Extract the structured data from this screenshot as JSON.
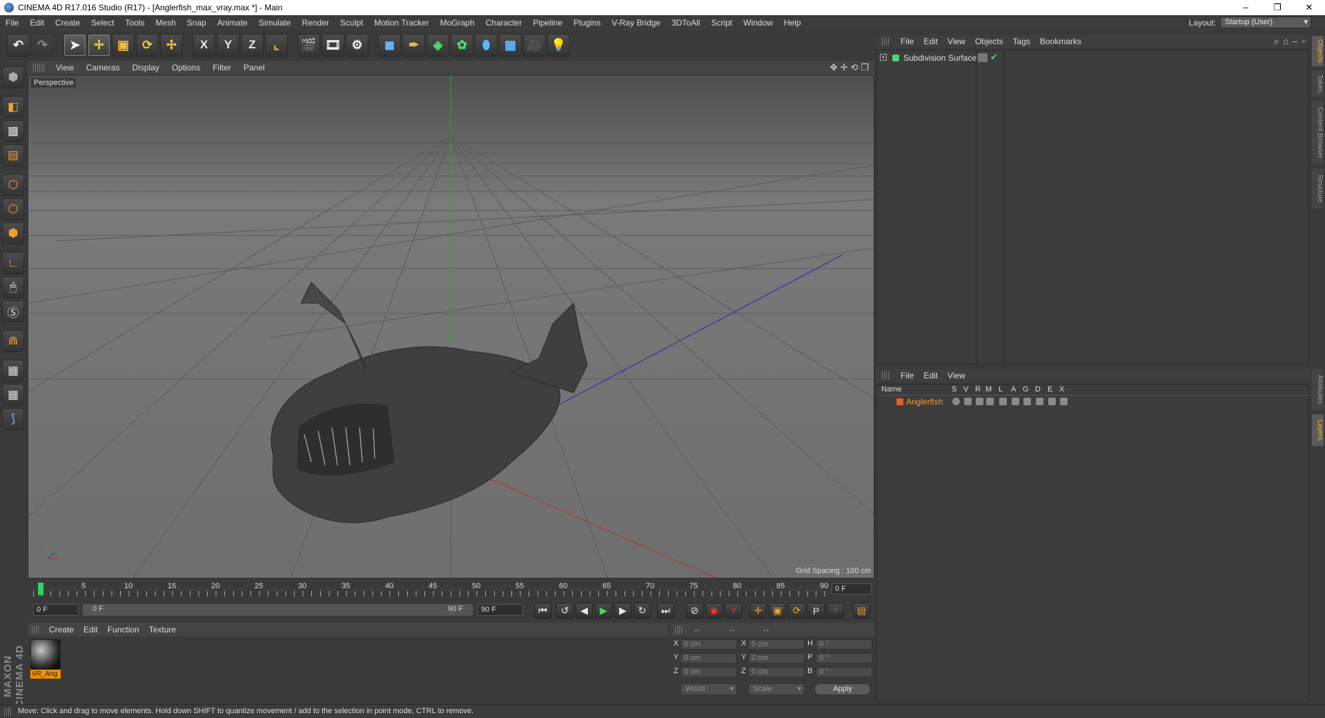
{
  "window": {
    "title": "CINEMA 4D R17.016 Studio (R17) - [Anglerfish_max_vray.max *] - Main",
    "controls": [
      "–",
      "❐",
      "✕"
    ]
  },
  "menu": [
    "File",
    "Edit",
    "Create",
    "Select",
    "Tools",
    "Mesh",
    "Snap",
    "Animate",
    "Simulate",
    "Render",
    "Sculpt",
    "Motion Tracker",
    "MoGraph",
    "Character",
    "Pipeline",
    "Plugins",
    "V-Ray Bridge",
    "3DToAll",
    "Script",
    "Window",
    "Help"
  ],
  "layout": {
    "label": "Layout:",
    "value": "Startup (User)"
  },
  "toolbar": {
    "icons": [
      "undo-icon",
      "redo-icon",
      "select-arrow-icon",
      "move-icon",
      "scale-icon",
      "rotate-icon",
      "live-select-icon",
      "x-axis-icon",
      "y-axis-icon",
      "z-axis-icon",
      "coordinate-system-icon",
      "render-view-icon",
      "render-picture-viewer-icon",
      "render-settings-icon",
      "cube-icon",
      "pen-spline-icon",
      "subdivision-icon",
      "cloner-icon",
      "deformer-icon",
      "floor-icon",
      "camera-icon",
      "light-icon"
    ],
    "labels": {
      "x": "X",
      "y": "Y",
      "z": "Z"
    }
  },
  "leftbar": {
    "icons": [
      "make-editable-icon",
      "model-mode-icon",
      "texture-mode-icon",
      "workplane-icon",
      "points-mode-icon",
      "edges-mode-icon",
      "polygons-mode-icon",
      "axis-mode-icon",
      "tweak-mode-icon",
      "solo-mode-icon",
      "snap-magnet-icon",
      "grid-lock-icon",
      "grid-snap-icon",
      "python-icon"
    ]
  },
  "maxon": "MAXON CINEMA 4D",
  "viewport": {
    "menu": [
      "View",
      "Cameras",
      "Display",
      "Options",
      "Filter",
      "Panel"
    ],
    "label": "Perspective",
    "grid_spacing": "Grid Spacing : 100 cm",
    "nav_icons": [
      "✥",
      "✛",
      "⟲",
      "❐"
    ]
  },
  "timeline": {
    "ticks": [
      "0",
      "5",
      "10",
      "15",
      "20",
      "25",
      "30",
      "35",
      "40",
      "45",
      "50",
      "55",
      "60",
      "65",
      "70",
      "75",
      "80",
      "85",
      "90"
    ],
    "current": "0",
    "end_field": "0 F",
    "start": "0 F",
    "range_start": "0 F",
    "range_end": "90 F",
    "end": "90 F"
  },
  "transport": {
    "buttons": [
      {
        "name": "goto-start-icon",
        "glyph": "⏮"
      },
      {
        "name": "prev-key-icon",
        "glyph": "↺"
      },
      {
        "name": "prev-frame-icon",
        "glyph": "◀"
      },
      {
        "name": "play-icon",
        "glyph": "▶"
      },
      {
        "name": "next-frame-icon",
        "glyph": "▶"
      },
      {
        "name": "next-key-icon",
        "glyph": "↻"
      },
      {
        "name": "goto-end-icon",
        "glyph": "⏭"
      }
    ],
    "key_buttons": [
      {
        "name": "motion-record-icon",
        "glyph": "⊘"
      },
      {
        "name": "record-active-icon",
        "glyph": "◉"
      },
      {
        "name": "autokey-icon",
        "glyph": "?"
      },
      {
        "name": "key-move-icon",
        "glyph": "✛"
      },
      {
        "name": "key-scale-icon",
        "glyph": "▣"
      },
      {
        "name": "key-rotate-icon",
        "glyph": "⟳"
      },
      {
        "name": "key-param-icon",
        "glyph": "P"
      },
      {
        "name": "key-pla-icon",
        "glyph": "⁘"
      },
      {
        "name": "timeline-icon",
        "glyph": "▤"
      }
    ]
  },
  "materials": {
    "menu": [
      "Create",
      "Edit",
      "Function",
      "Texture"
    ],
    "items": [
      {
        "name": "VR_Ang"
      }
    ]
  },
  "coordinates": {
    "header": [
      "--",
      "--",
      "--"
    ],
    "rows": [
      {
        "a": "X",
        "av": "0 cm",
        "b": "X",
        "bv": "0 cm",
        "c": "H",
        "cv": "0 °"
      },
      {
        "a": "Y",
        "av": "0 cm",
        "b": "Y",
        "bv": "0 cm",
        "c": "P",
        "cv": "0 °"
      },
      {
        "a": "Z",
        "av": "0 cm",
        "b": "Z",
        "bv": "0 cm",
        "c": "B",
        "cv": "0 °"
      }
    ],
    "mode": "World",
    "size_mode": "Scale",
    "apply": "Apply"
  },
  "objects": {
    "menu": [
      "File",
      "Edit",
      "View",
      "Objects",
      "Tags",
      "Bookmarks"
    ],
    "items": [
      {
        "name": "Subdivision Surface"
      }
    ]
  },
  "layers": {
    "menu": [
      "File",
      "Edit",
      "View"
    ],
    "columns": [
      "Name",
      "S",
      "V",
      "R",
      "M",
      "L",
      "A",
      "G",
      "D",
      "E",
      "X"
    ],
    "items": [
      {
        "name": "Anglerfish"
      }
    ]
  },
  "side_tabs": [
    "Objects",
    "Takes",
    "Content Browser",
    "Structure",
    "Attributes",
    "Layers"
  ],
  "status": "Move: Click and drag to move elements. Hold down SHIFT to quantize movement / add to the selection in point mode, CTRL to remove."
}
